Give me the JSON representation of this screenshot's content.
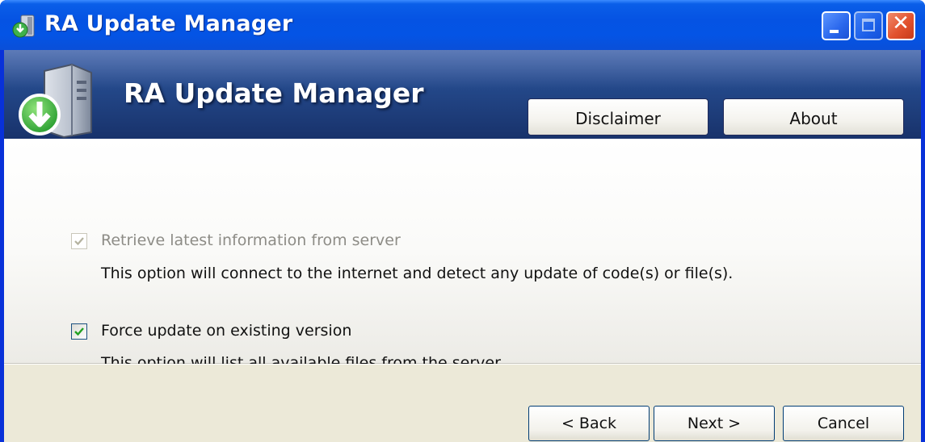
{
  "window": {
    "title": "RA Update Manager",
    "icon": "download-server-icon",
    "controls": {
      "minimize": "minimize-icon",
      "maximize": "maximize-icon",
      "close_glyph": "✕"
    },
    "accent": "#0553e3"
  },
  "banner": {
    "title": "RA Update Manager",
    "icon": "server-download-icon",
    "buttons": {
      "disclaimer": "Disclaimer",
      "about": "About"
    },
    "color": "#234788"
  },
  "options": [
    {
      "label": "Retrieve latest information from server",
      "description": "This option will connect to the internet and detect any update of code(s) or file(s).",
      "checked": true,
      "enabled": false
    },
    {
      "label": "Force update on existing version",
      "description": "This option will list all available files from the server.",
      "checked": true,
      "enabled": true
    }
  ],
  "footer": {
    "back": "< Back",
    "next": "Next >",
    "cancel": "Cancel"
  }
}
